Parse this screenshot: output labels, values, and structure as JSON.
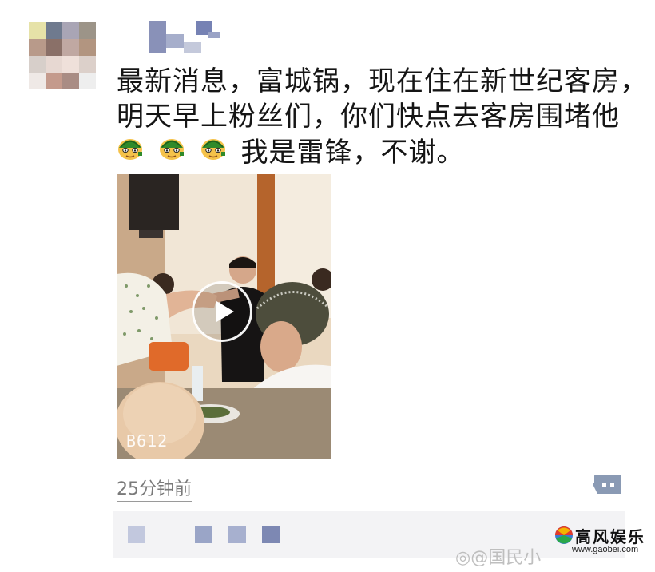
{
  "post": {
    "line1": "最新消息，富城锅，现在住在新世纪客房，",
    "line2": "明天早上粉丝们，你们快点去客房围堵他",
    "line3_text": "我是雷锋，不谢。",
    "emoji_names": [
      "turtle-face-icon",
      "turtle-face-icon",
      "turtle-face-icon"
    ],
    "timestamp": "25分钟前"
  },
  "video": {
    "watermark": "B612",
    "icon": "play-icon"
  },
  "actions": {
    "comment_icon": "comment-dots-icon"
  },
  "overlay": {
    "brand_name": "高风娱乐",
    "brand_url": "www.gaobei.com",
    "weibo_watermark": "@国民小"
  },
  "colors": {
    "interaction_bar": "#f3f3f5",
    "comment_button": "#8a9ab4",
    "mosaic_blue": "#7d88b3"
  }
}
